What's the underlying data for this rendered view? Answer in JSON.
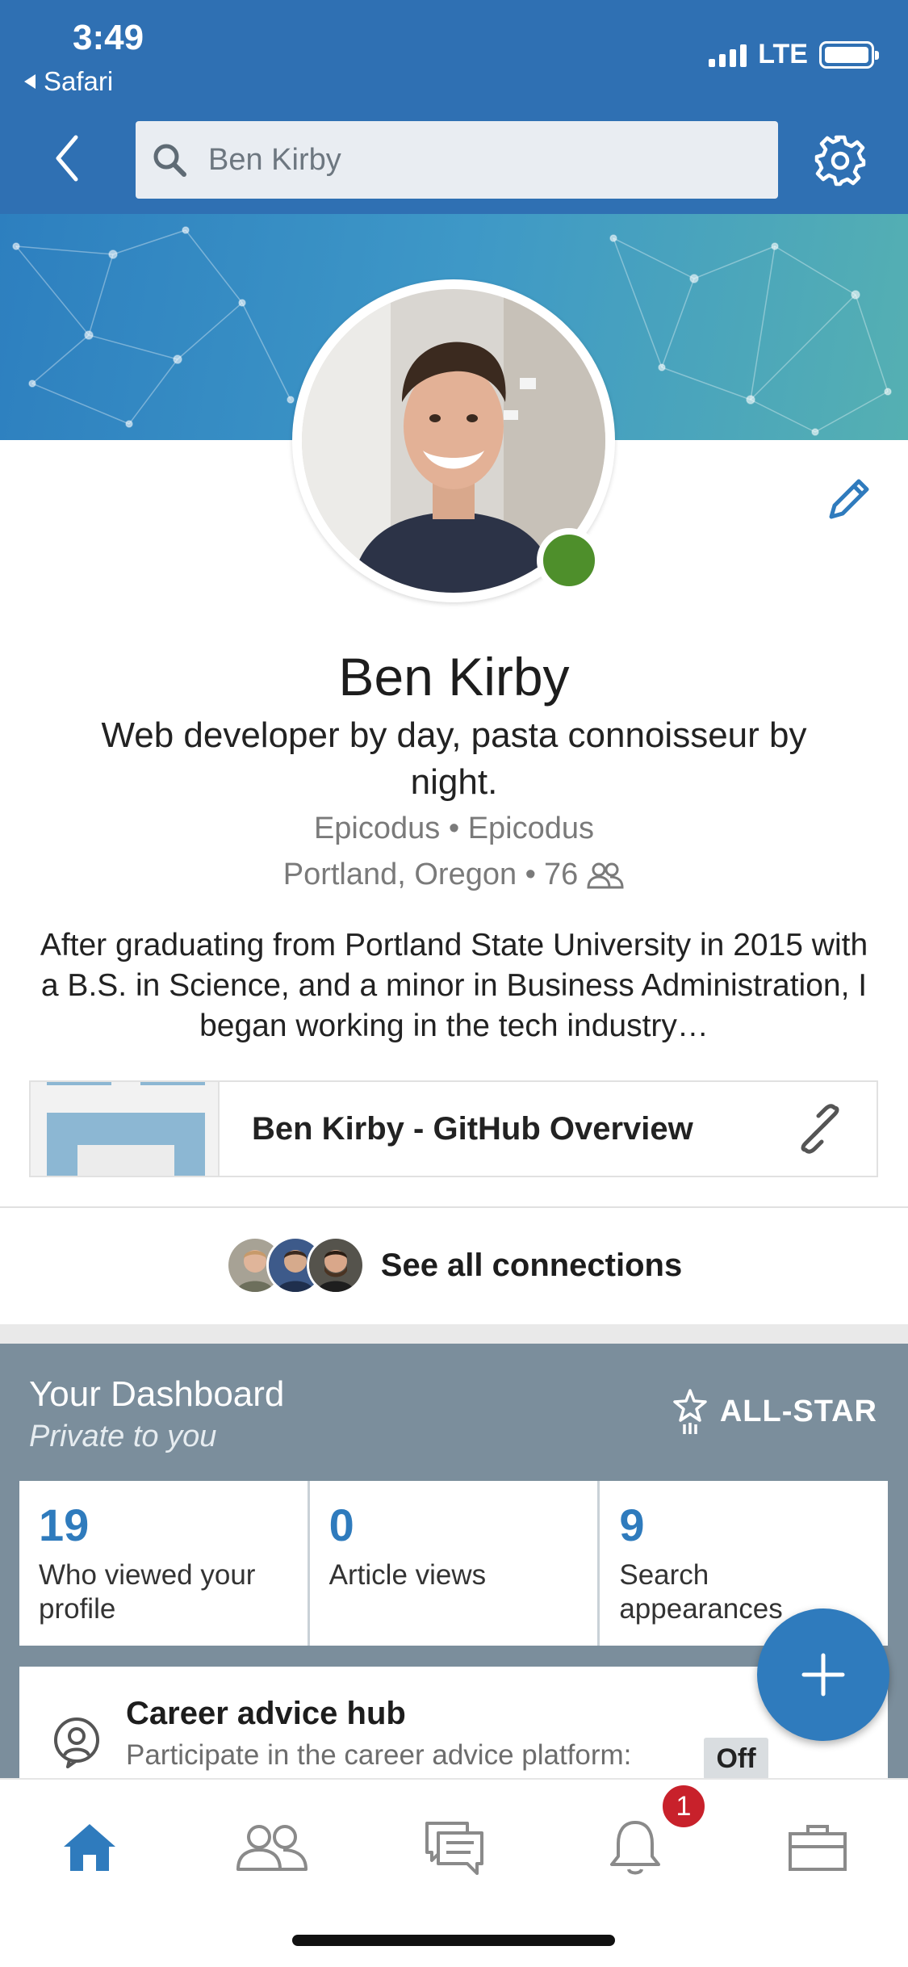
{
  "status_bar": {
    "time": "3:49",
    "back_app": "Safari",
    "network": "LTE"
  },
  "header": {
    "search_value": "Ben Kirby"
  },
  "profile": {
    "name": "Ben Kirby",
    "headline": "Web developer by day, pasta connoisseur by night.",
    "company": "Epicodus • Epicodus",
    "location": "Portland, Oregon •",
    "connections_count": "76",
    "summary": "After graduating from Portland State University in 2015 with a B.S. in Science, and a minor in Business Administration, I began working in the tech industry…",
    "online_color": "#4e8f2b"
  },
  "link_card": {
    "title": "Ben Kirby - GitHub Overview"
  },
  "connections": {
    "label": "See all connections"
  },
  "dashboard": {
    "title": "Your Dashboard",
    "subtitle": "Private to you",
    "badge": "ALL-STAR",
    "stats": [
      {
        "value": "19",
        "label": "Who viewed your profile"
      },
      {
        "value": "0",
        "label": "Article views"
      },
      {
        "value": "9",
        "label": "Search appearances"
      }
    ]
  },
  "career": {
    "title": "Career advice hub",
    "description": "Participate in the career advice platform:",
    "toggle": "Off"
  },
  "tabbar": {
    "items": [
      "home-icon",
      "people-icon",
      "messages-icon",
      "notifications-icon",
      "jobs-icon"
    ],
    "notification_count": "1",
    "accent": "#2f7bbd"
  }
}
